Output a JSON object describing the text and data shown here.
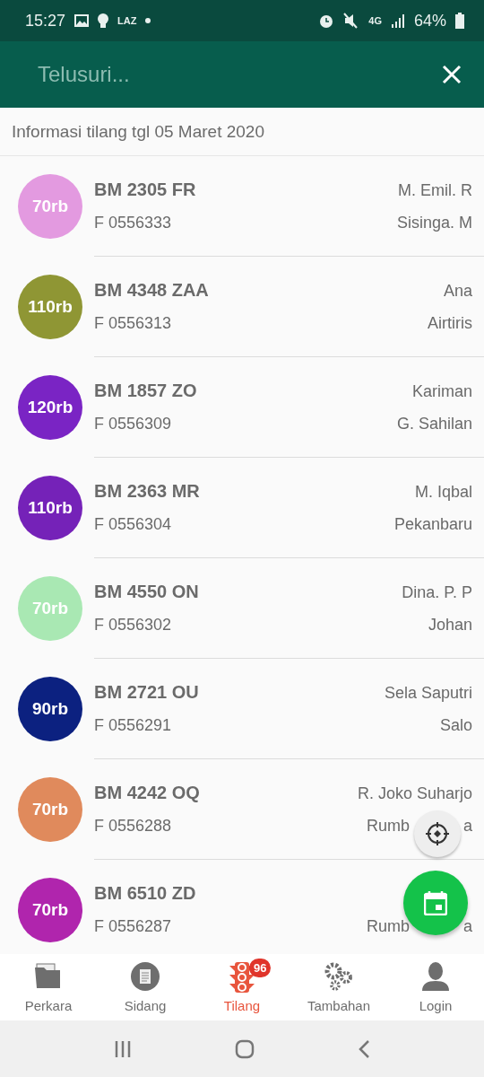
{
  "status_bar": {
    "time": "15:27",
    "carrier": "LAZ",
    "battery": "64%",
    "network": "4G"
  },
  "search": {
    "placeholder": "Telusuri..."
  },
  "header": "Informasi tilang tgl 05 Maret 2020",
  "rows": [
    {
      "amount": "70rb",
      "color": "#e39ae0",
      "plate": "BM 2305 FR",
      "number": "F 0556333",
      "name": "M. Emil. R",
      "place": "Sisinga. M"
    },
    {
      "amount": "110rb",
      "color": "#8f9634",
      "plate": "BM 4348 ZAA",
      "number": "F 0556313",
      "name": "Ana",
      "place": "Airtiris"
    },
    {
      "amount": "120rb",
      "color": "#7a24c4",
      "plate": "BM 1857 ZO",
      "number": "F 0556309",
      "name": "Kariman",
      "place": "G. Sahilan"
    },
    {
      "amount": "110rb",
      "color": "#7522b8",
      "plate": "BM 2363 MR",
      "number": "F 0556304",
      "name": "M. Iqbal",
      "place": "Pekanbaru"
    },
    {
      "amount": "70rb",
      "color": "#a9e8b3",
      "plate": "BM 4550 ON",
      "number": "F 0556302",
      "name": "Dina. P. P",
      "place": "Johan"
    },
    {
      "amount": "90rb",
      "color": "#0c2180",
      "plate": "BM 2721 OU",
      "number": "F 0556291",
      "name": "Sela Saputri",
      "place": "Salo"
    },
    {
      "amount": "70rb",
      "color": "#e08a5c",
      "plate": "BM 4242 OQ",
      "number": "F 0556288",
      "name": "R. Joko Suharjo",
      "place": "Rumb",
      "place_tail": "a"
    },
    {
      "amount": "70rb",
      "color": "#b025ad",
      "plate": "BM 6510 ZD",
      "number": "F 0556287",
      "place": "Rumb",
      "place_tail": "a"
    }
  ],
  "nav": [
    {
      "kind": "folder",
      "label": "Perkara",
      "selected": false
    },
    {
      "kind": "document",
      "label": "Sidang",
      "selected": false
    },
    {
      "kind": "traffic",
      "label": "Tilang",
      "selected": true,
      "badge": "96"
    },
    {
      "kind": "gears",
      "label": "Tambahan",
      "selected": false
    },
    {
      "kind": "person",
      "label": "Login",
      "selected": false
    }
  ]
}
